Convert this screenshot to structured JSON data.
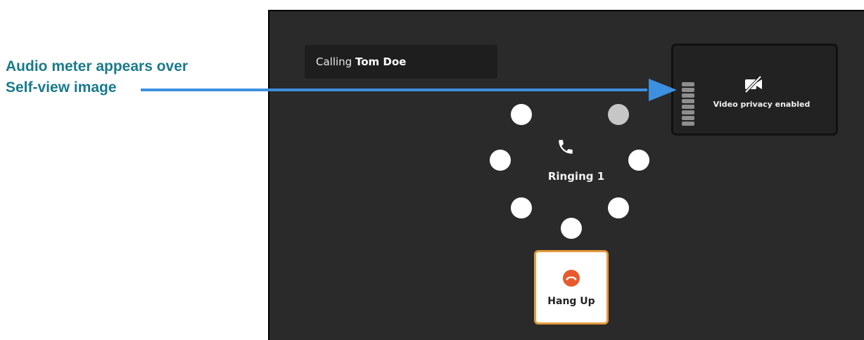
{
  "annotation": {
    "line1": "Audio meter appears over",
    "line2": "Self-view image"
  },
  "call": {
    "calling_prefix": "Calling",
    "callee_name": "Tom Doe",
    "status": "Ringing 1"
  },
  "selfview": {
    "privacy_text": "Video privacy enabled",
    "meter_bars": 8
  },
  "controls": {
    "hangup_label": "Hang Up"
  },
  "icons": {
    "phone": "phone-icon",
    "video_off": "video-off-icon",
    "hangup": "hangup-icon"
  },
  "colors": {
    "annotation_text": "#1a7a8c",
    "arrow": "#3d8fe0",
    "screen_bg": "#2a2a2a",
    "hangup_border": "#e39a3b",
    "hangup_icon": "#e85a2d"
  }
}
